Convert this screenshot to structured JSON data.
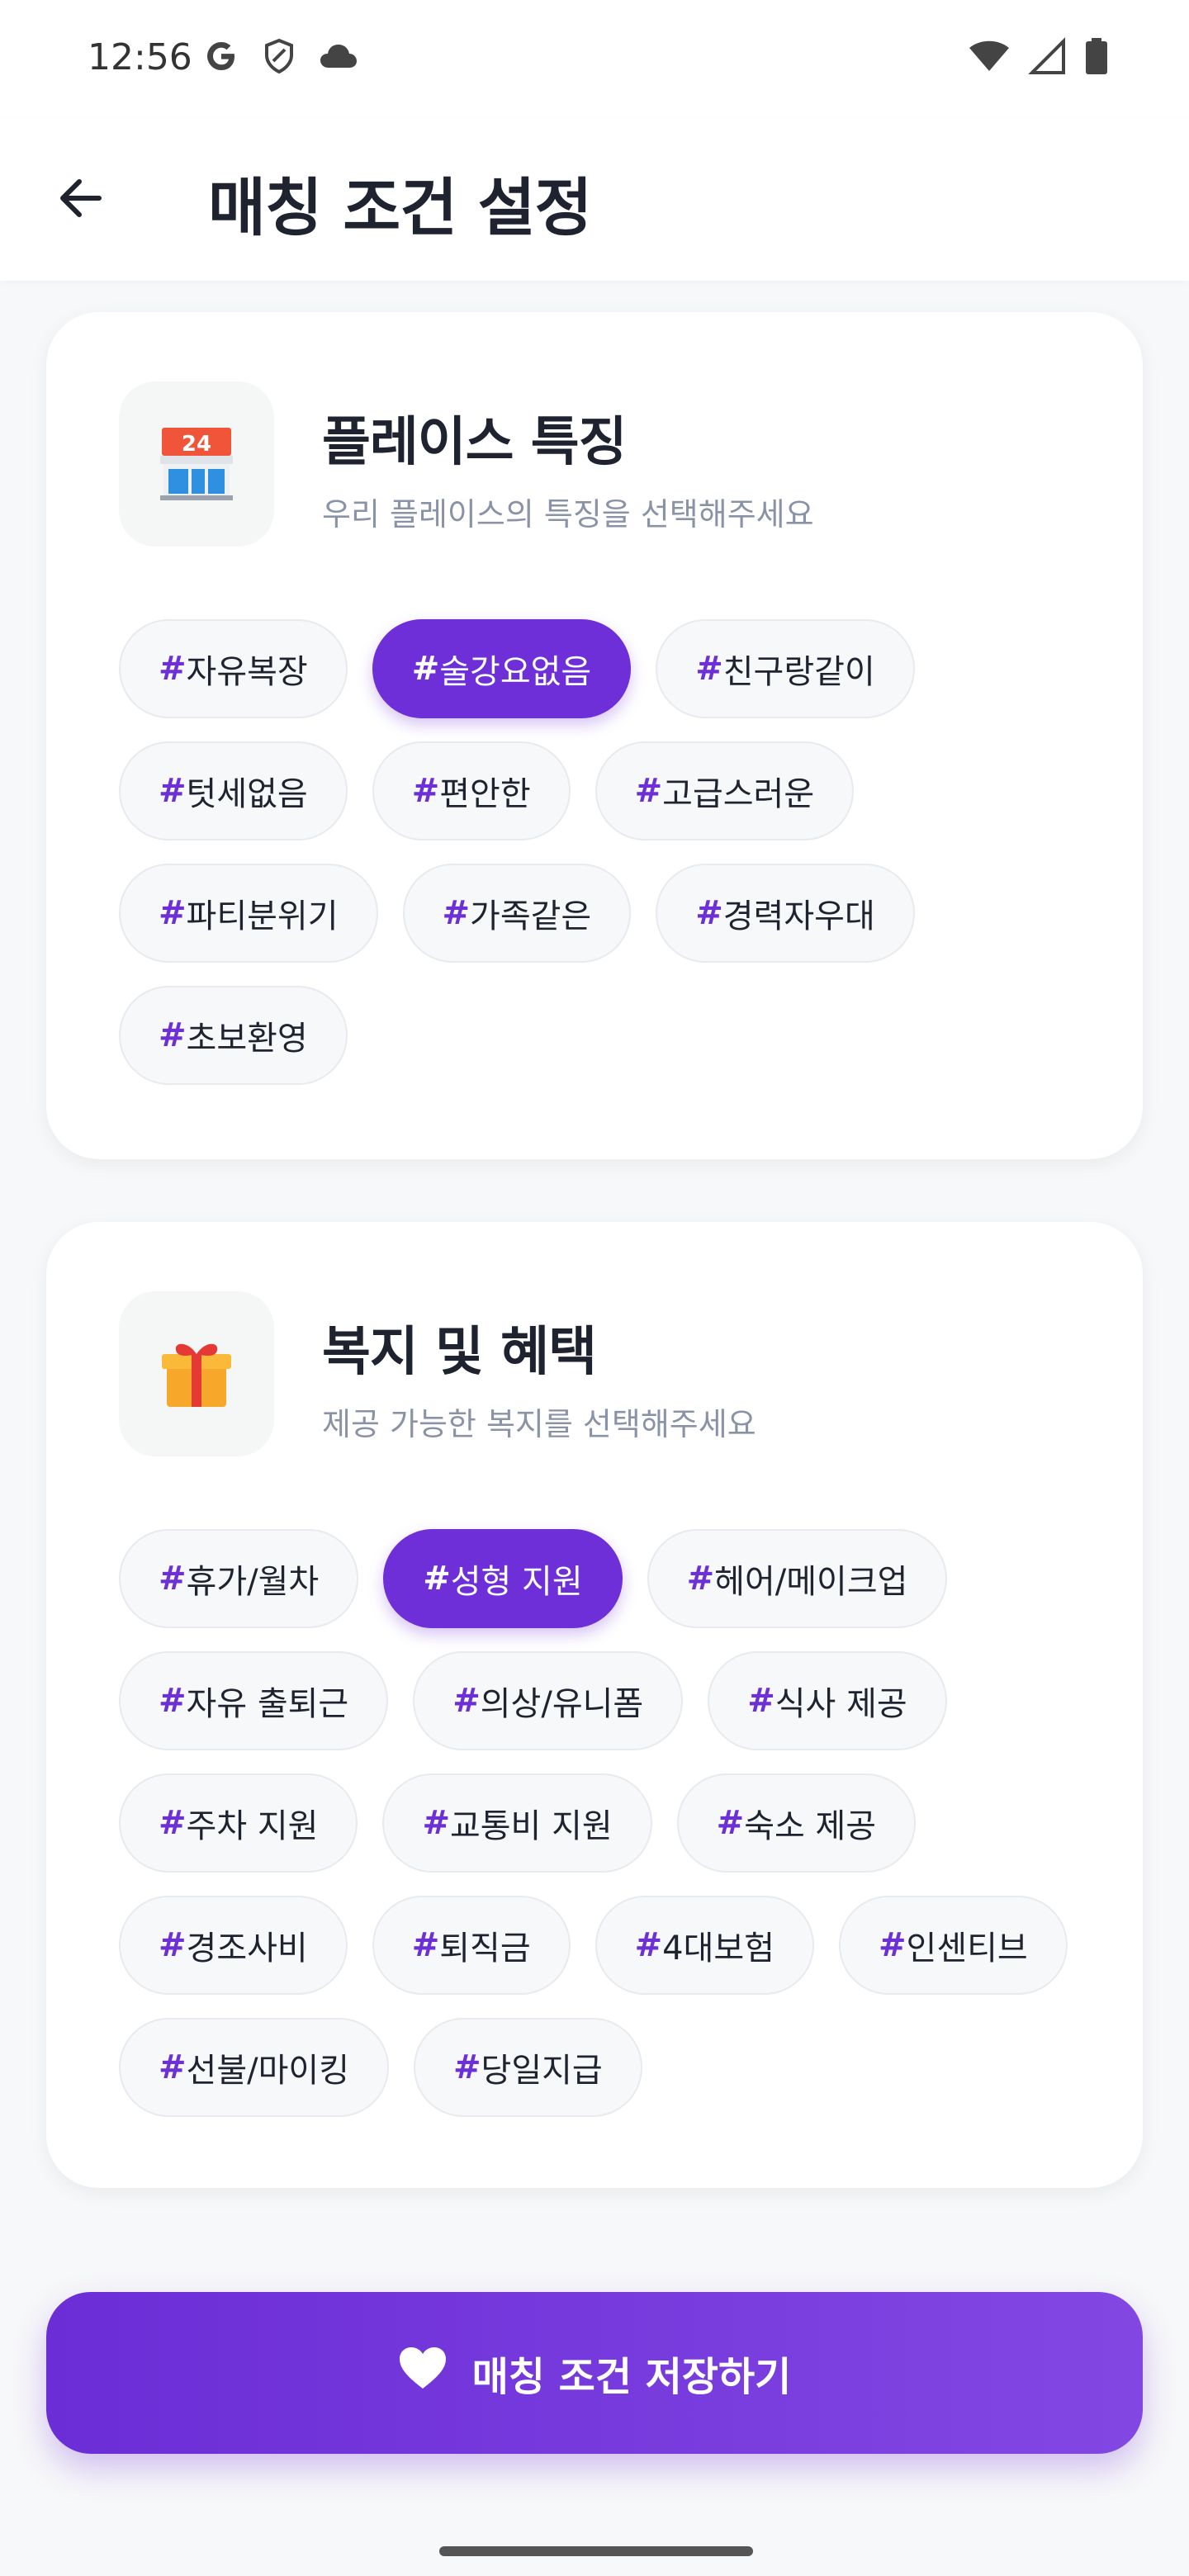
{
  "status_bar": {
    "time": "12:56",
    "icons_left": [
      "google-icon",
      "shield-icon",
      "cloud-icon"
    ],
    "icons_right": [
      "wifi-icon",
      "signal-icon",
      "battery-icon"
    ]
  },
  "app_bar": {
    "back_icon": "arrow-left-icon",
    "title": "매칭 조건 설정"
  },
  "sections": [
    {
      "icon": "convenience-store-icon",
      "title": "플레이스 특징",
      "subtitle": "우리 플레이스의 특징을 선택해주세요",
      "tags": [
        {
          "label": "자유복장",
          "selected": false
        },
        {
          "label": "술강요없음",
          "selected": true
        },
        {
          "label": "친구랑같이",
          "selected": false
        },
        {
          "label": "텃세없음",
          "selected": false
        },
        {
          "label": "편안한",
          "selected": false
        },
        {
          "label": "고급스러운",
          "selected": false
        },
        {
          "label": "파티분위기",
          "selected": false
        },
        {
          "label": "가족같은",
          "selected": false
        },
        {
          "label": "경력자우대",
          "selected": false
        },
        {
          "label": "초보환영",
          "selected": false
        }
      ]
    },
    {
      "icon": "gift-icon",
      "title": "복지 및 혜택",
      "subtitle": "제공 가능한 복지를 선택해주세요",
      "tags": [
        {
          "label": "휴가/월차",
          "selected": false
        },
        {
          "label": "성형 지원",
          "selected": true
        },
        {
          "label": "헤어/메이크업",
          "selected": false
        },
        {
          "label": "자유 출퇴근",
          "selected": false
        },
        {
          "label": "의상/유니폼",
          "selected": false
        },
        {
          "label": "식사 제공",
          "selected": false
        },
        {
          "label": "주차 지원",
          "selected": false
        },
        {
          "label": "교통비 지원",
          "selected": false
        },
        {
          "label": "숙소 제공",
          "selected": false
        },
        {
          "label": "경조사비",
          "selected": false
        },
        {
          "label": "퇴직금",
          "selected": false
        },
        {
          "label": "4대보험",
          "selected": false
        },
        {
          "label": "인센티브",
          "selected": false
        },
        {
          "label": "선불/마이킹",
          "selected": false
        },
        {
          "label": "당일지급",
          "selected": false
        }
      ]
    }
  ],
  "tag_prefix": "#",
  "save_button": {
    "icon": "heart-icon",
    "label": "매칭 조건 저장하기"
  },
  "colors": {
    "accent": "#6e2fd8",
    "accent_light": "#8247e3",
    "text_primary": "#1f2330",
    "text_secondary": "#8a93a5"
  }
}
